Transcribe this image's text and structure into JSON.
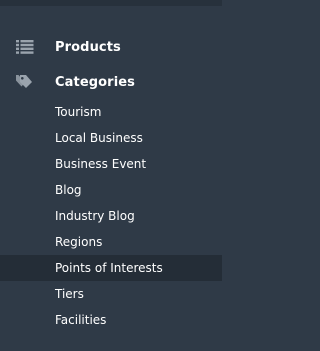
{
  "sidebar": {
    "sections": [
      {
        "label": "Products",
        "icon": "list-icon"
      },
      {
        "label": "Categories",
        "icon": "tags-icon"
      }
    ],
    "category_items": [
      {
        "label": "Tourism",
        "active": false
      },
      {
        "label": "Local Business",
        "active": false
      },
      {
        "label": "Business Event",
        "active": false
      },
      {
        "label": "Blog",
        "active": false
      },
      {
        "label": "Industry Blog",
        "active": false
      },
      {
        "label": "Regions",
        "active": false
      },
      {
        "label": "Points of Interests",
        "active": true
      },
      {
        "label": "Tiers",
        "active": false
      },
      {
        "label": "Facilities",
        "active": false
      }
    ]
  },
  "colors": {
    "background": "#2f3a47",
    "active_background": "#242d37",
    "icon": "#9aa3ad",
    "text": "#ffffff"
  }
}
